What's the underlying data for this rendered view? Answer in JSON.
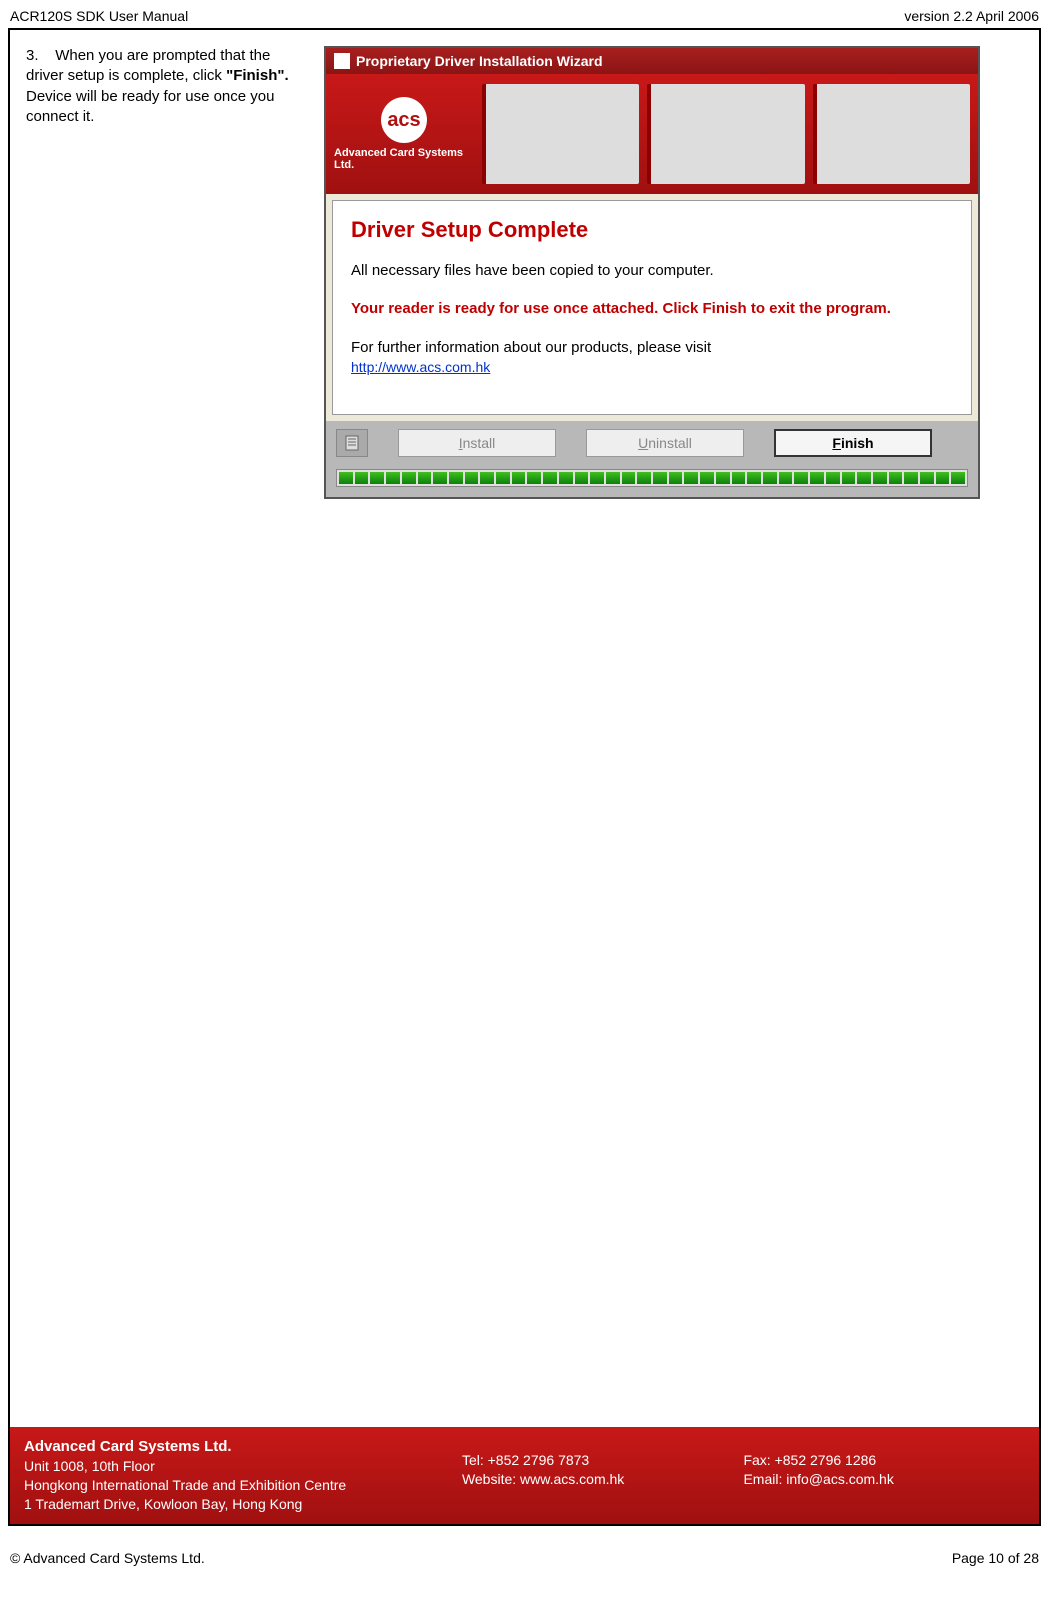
{
  "header": {
    "left": "ACR120S SDK User Manual",
    "right": "version 2.2 April 2006"
  },
  "instruction": {
    "num": "3.",
    "text_before_bold": "When you are prompted that the driver setup is complete, click ",
    "bold": "\"Finish\".",
    "text_after_bold": " Device will be ready for use once you connect it."
  },
  "wizard": {
    "title": "Proprietary Driver Installation Wizard",
    "logo_text": "acs",
    "logo_sub": "Advanced Card Systems Ltd.",
    "heading": "Driver Setup Complete",
    "line1": "All necessary files have been copied to your computer.",
    "line2": "Your reader is ready for use once attached. Click Finish to exit the program.",
    "line3": "For further information about our products, please visit",
    "link": "http://www.acs.com.hk",
    "buttons": {
      "install_u": "I",
      "install_rest": "nstall",
      "uninstall_u": "U",
      "uninstall_rest": "ninstall",
      "finish_u": "F",
      "finish_rest": "inish"
    }
  },
  "footer_strip": {
    "company": "Advanced Card Systems Ltd.",
    "addr1": "Unit 1008, 10th Floor",
    "addr2": "Hongkong International Trade and Exhibition Centre",
    "addr3": "1 Trademart Drive, Kowloon Bay, Hong Kong",
    "tel": "Tel: +852 2796 7873",
    "website": "Website: www.acs.com.hk",
    "fax": "Fax: +852 2796 1286",
    "email": "Email: info@acs.com.hk"
  },
  "page_footer": {
    "left": "© Advanced Card Systems Ltd.",
    "right": "Page 10 of 28"
  }
}
